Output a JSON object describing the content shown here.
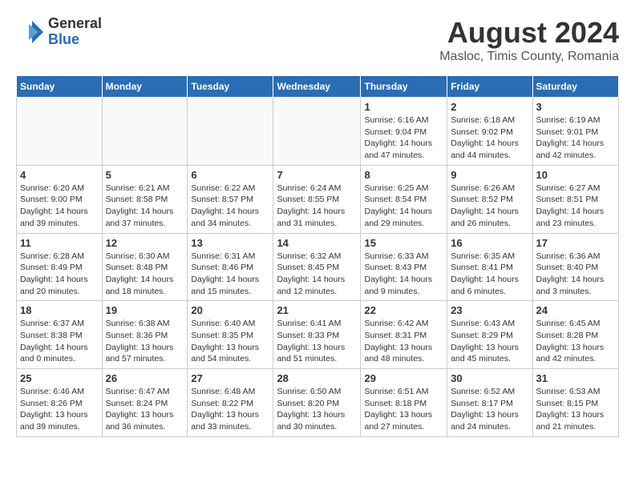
{
  "header": {
    "logo_general": "General",
    "logo_blue": "Blue",
    "month_title": "August 2024",
    "location": "Masloc, Timis County, Romania"
  },
  "weekdays": [
    "Sunday",
    "Monday",
    "Tuesday",
    "Wednesday",
    "Thursday",
    "Friday",
    "Saturday"
  ],
  "weeks": [
    [
      {
        "day": "",
        "info": ""
      },
      {
        "day": "",
        "info": ""
      },
      {
        "day": "",
        "info": ""
      },
      {
        "day": "",
        "info": ""
      },
      {
        "day": "1",
        "info": "Sunrise: 6:16 AM\nSunset: 9:04 PM\nDaylight: 14 hours and 47 minutes."
      },
      {
        "day": "2",
        "info": "Sunrise: 6:18 AM\nSunset: 9:02 PM\nDaylight: 14 hours and 44 minutes."
      },
      {
        "day": "3",
        "info": "Sunrise: 6:19 AM\nSunset: 9:01 PM\nDaylight: 14 hours and 42 minutes."
      }
    ],
    [
      {
        "day": "4",
        "info": "Sunrise: 6:20 AM\nSunset: 9:00 PM\nDaylight: 14 hours and 39 minutes."
      },
      {
        "day": "5",
        "info": "Sunrise: 6:21 AM\nSunset: 8:58 PM\nDaylight: 14 hours and 37 minutes."
      },
      {
        "day": "6",
        "info": "Sunrise: 6:22 AM\nSunset: 8:57 PM\nDaylight: 14 hours and 34 minutes."
      },
      {
        "day": "7",
        "info": "Sunrise: 6:24 AM\nSunset: 8:55 PM\nDaylight: 14 hours and 31 minutes."
      },
      {
        "day": "8",
        "info": "Sunrise: 6:25 AM\nSunset: 8:54 PM\nDaylight: 14 hours and 29 minutes."
      },
      {
        "day": "9",
        "info": "Sunrise: 6:26 AM\nSunset: 8:52 PM\nDaylight: 14 hours and 26 minutes."
      },
      {
        "day": "10",
        "info": "Sunrise: 6:27 AM\nSunset: 8:51 PM\nDaylight: 14 hours and 23 minutes."
      }
    ],
    [
      {
        "day": "11",
        "info": "Sunrise: 6:28 AM\nSunset: 8:49 PM\nDaylight: 14 hours and 20 minutes."
      },
      {
        "day": "12",
        "info": "Sunrise: 6:30 AM\nSunset: 8:48 PM\nDaylight: 14 hours and 18 minutes."
      },
      {
        "day": "13",
        "info": "Sunrise: 6:31 AM\nSunset: 8:46 PM\nDaylight: 14 hours and 15 minutes."
      },
      {
        "day": "14",
        "info": "Sunrise: 6:32 AM\nSunset: 8:45 PM\nDaylight: 14 hours and 12 minutes."
      },
      {
        "day": "15",
        "info": "Sunrise: 6:33 AM\nSunset: 8:43 PM\nDaylight: 14 hours and 9 minutes."
      },
      {
        "day": "16",
        "info": "Sunrise: 6:35 AM\nSunset: 8:41 PM\nDaylight: 14 hours and 6 minutes."
      },
      {
        "day": "17",
        "info": "Sunrise: 6:36 AM\nSunset: 8:40 PM\nDaylight: 14 hours and 3 minutes."
      }
    ],
    [
      {
        "day": "18",
        "info": "Sunrise: 6:37 AM\nSunset: 8:38 PM\nDaylight: 14 hours and 0 minutes."
      },
      {
        "day": "19",
        "info": "Sunrise: 6:38 AM\nSunset: 8:36 PM\nDaylight: 13 hours and 57 minutes."
      },
      {
        "day": "20",
        "info": "Sunrise: 6:40 AM\nSunset: 8:35 PM\nDaylight: 13 hours and 54 minutes."
      },
      {
        "day": "21",
        "info": "Sunrise: 6:41 AM\nSunset: 8:33 PM\nDaylight: 13 hours and 51 minutes."
      },
      {
        "day": "22",
        "info": "Sunrise: 6:42 AM\nSunset: 8:31 PM\nDaylight: 13 hours and 48 minutes."
      },
      {
        "day": "23",
        "info": "Sunrise: 6:43 AM\nSunset: 8:29 PM\nDaylight: 13 hours and 45 minutes."
      },
      {
        "day": "24",
        "info": "Sunrise: 6:45 AM\nSunset: 8:28 PM\nDaylight: 13 hours and 42 minutes."
      }
    ],
    [
      {
        "day": "25",
        "info": "Sunrise: 6:46 AM\nSunset: 8:26 PM\nDaylight: 13 hours and 39 minutes."
      },
      {
        "day": "26",
        "info": "Sunrise: 6:47 AM\nSunset: 8:24 PM\nDaylight: 13 hours and 36 minutes."
      },
      {
        "day": "27",
        "info": "Sunrise: 6:48 AM\nSunset: 8:22 PM\nDaylight: 13 hours and 33 minutes."
      },
      {
        "day": "28",
        "info": "Sunrise: 6:50 AM\nSunset: 8:20 PM\nDaylight: 13 hours and 30 minutes."
      },
      {
        "day": "29",
        "info": "Sunrise: 6:51 AM\nSunset: 8:18 PM\nDaylight: 13 hours and 27 minutes."
      },
      {
        "day": "30",
        "info": "Sunrise: 6:52 AM\nSunset: 8:17 PM\nDaylight: 13 hours and 24 minutes."
      },
      {
        "day": "31",
        "info": "Sunrise: 6:53 AM\nSunset: 8:15 PM\nDaylight: 13 hours and 21 minutes."
      }
    ]
  ]
}
